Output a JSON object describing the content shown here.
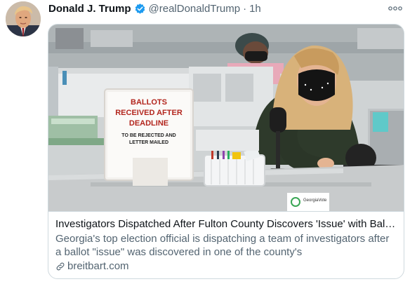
{
  "author": {
    "name": "Donald J. Trump",
    "handle": "@realDonaldTrump",
    "separator": "·",
    "time": "1h",
    "verified_icon": "verified-badge-icon",
    "verified_color": "#1d9bf0"
  },
  "menu": {
    "more_label": "ooo"
  },
  "card": {
    "title": "Investigators Dispatched After Fulton County Discovers 'Issue' with Ballo...",
    "description": "Georgia's top election official is dispatching a team of investigators after a ballot \"issue\" was discovered in one of the county's",
    "domain": "breitbart.com",
    "link_icon": "link-icon",
    "photo": {
      "sign_line1": "BALLOTS",
      "sign_line2": "RECEIVED AFTER",
      "sign_line3": "DEADLINE",
      "sign_line4": "TO BE REJECTED AND",
      "sign_line5": "LETTER MAILED",
      "sticker_text": "GeorgiaVote"
    }
  },
  "colors": {
    "text": "#0f1419",
    "muted": "#536471",
    "border": "#cfd9de",
    "sign_red": "#b3261e"
  }
}
